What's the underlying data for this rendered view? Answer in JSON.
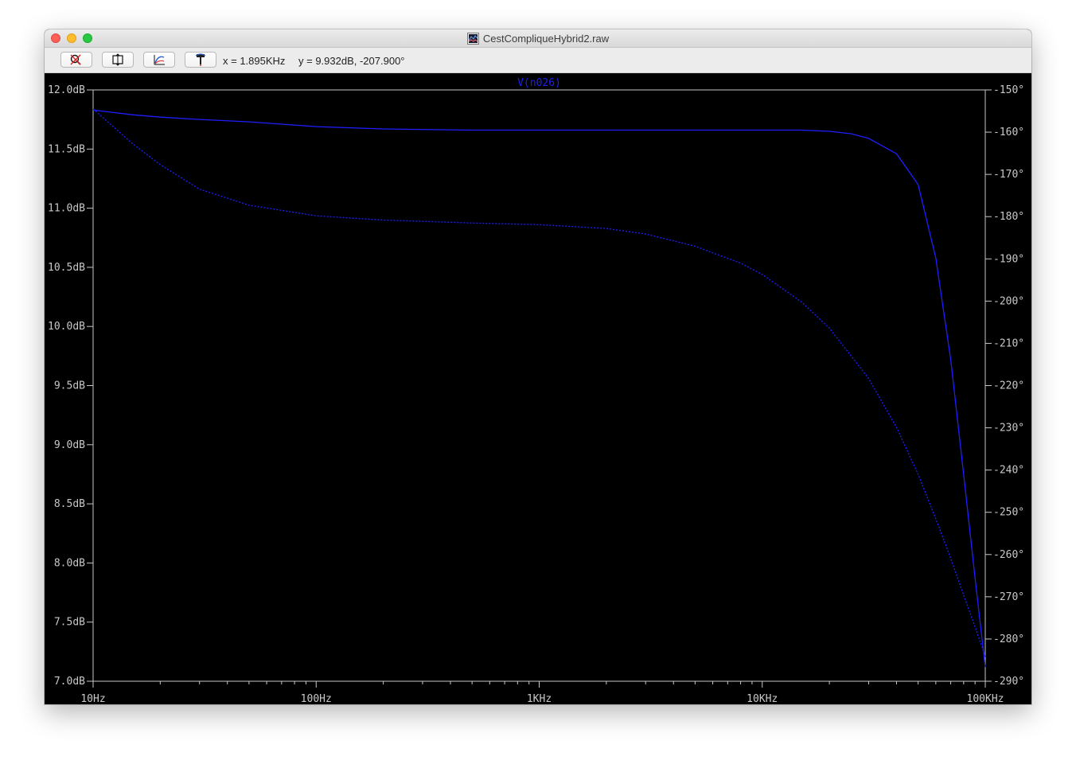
{
  "window": {
    "title": "CestCompliqueHybrid2.raw"
  },
  "toolbar": {
    "buttons": [
      {
        "icon": "zoom-out-icon"
      },
      {
        "icon": "autorange-icon"
      },
      {
        "icon": "fit-curve-icon"
      },
      {
        "icon": "probe-icon"
      }
    ],
    "cursor_x": "x = 1.895KHz",
    "cursor_y": "y = 9.932dB, -207.900°"
  },
  "colors": {
    "trace": "#1e1eff",
    "axis": "#c8c8c8",
    "background": "#000000"
  },
  "chart_data": {
    "type": "line",
    "title": "V(n026)",
    "xscale": "log",
    "xlim": [
      10,
      100000
    ],
    "x_ticks": [
      "10Hz",
      "100Hz",
      "1KHz",
      "10KHz",
      "100KHz"
    ],
    "y_left_ticks": [
      "12.0dB",
      "11.5dB",
      "11.0dB",
      "10.5dB",
      "10.0dB",
      "9.5dB",
      "9.0dB",
      "8.5dB",
      "8.0dB",
      "7.5dB",
      "7.0dB"
    ],
    "y_right_ticks": [
      "-150°",
      "-160°",
      "-170°",
      "-180°",
      "-190°",
      "-200°",
      "-210°",
      "-220°",
      "-230°",
      "-240°",
      "-250°",
      "-260°",
      "-270°",
      "-280°",
      "-290°"
    ],
    "ylim_left": [
      7.0,
      12.0
    ],
    "ylim_right": [
      -290,
      -150
    ],
    "series": [
      {
        "name": "V(n026)",
        "axis": "left",
        "style": "solid",
        "x": [
          10,
          15,
          20,
          30,
          50,
          100,
          200,
          500,
          1000,
          2000,
          5000,
          10000,
          15000,
          20000,
          25000,
          30000,
          40000,
          50000,
          60000,
          70000,
          80000,
          90000,
          100000
        ],
        "y": [
          11.83,
          11.79,
          11.77,
          11.75,
          11.73,
          11.69,
          11.67,
          11.66,
          11.66,
          11.66,
          11.66,
          11.66,
          11.66,
          11.65,
          11.63,
          11.59,
          11.46,
          11.2,
          10.58,
          9.72,
          8.75,
          7.87,
          7.12
        ]
      },
      {
        "name": "V(n026) phase",
        "axis": "right",
        "style": "dotted",
        "x": [
          10,
          15,
          20,
          30,
          50,
          100,
          200,
          500,
          1000,
          2000,
          3000,
          5000,
          8000,
          10000,
          15000,
          20000,
          30000,
          40000,
          50000,
          60000,
          70000,
          80000,
          90000,
          100000
        ],
        "y": [
          -154.5,
          -162.7,
          -167.7,
          -173.5,
          -177.3,
          -179.8,
          -180.8,
          -181.5,
          -181.9,
          -182.8,
          -184.1,
          -187,
          -191,
          -193.7,
          -200.2,
          -206.4,
          -218.3,
          -229.9,
          -241,
          -251.5,
          -260.9,
          -269.6,
          -277.1,
          -284.2
        ]
      }
    ]
  }
}
